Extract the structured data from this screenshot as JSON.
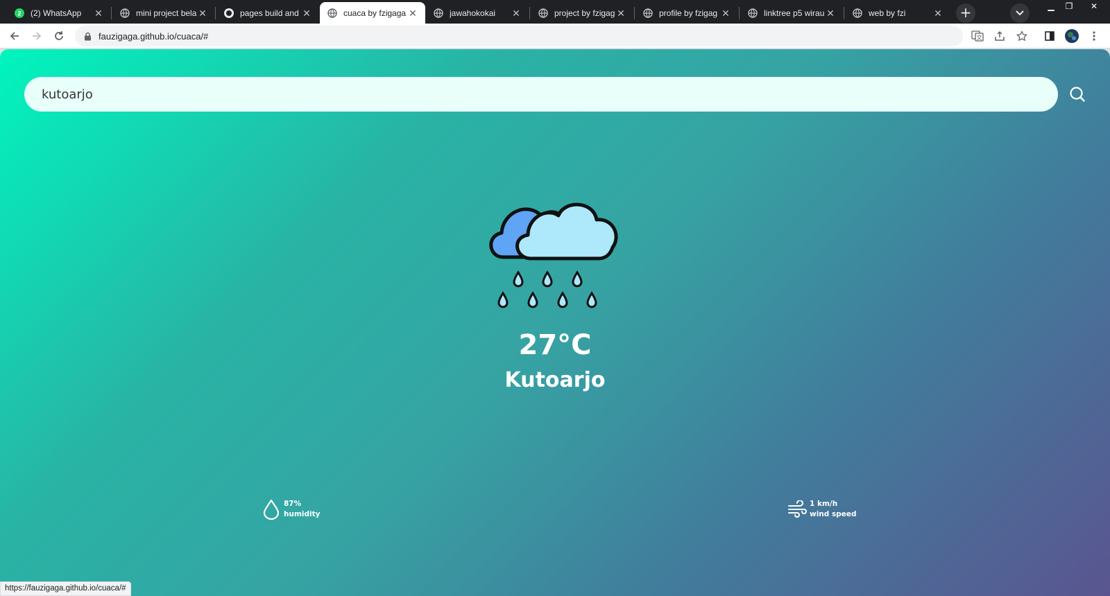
{
  "browser": {
    "tabs": [
      {
        "title": "(2) WhatsApp",
        "favicon": "whatsapp-icon"
      },
      {
        "title": "mini project bela",
        "favicon": "globe-icon"
      },
      {
        "title": "pages build and",
        "favicon": "github-icon"
      },
      {
        "title": "cuaca by fzigaga",
        "favicon": "globe-icon",
        "active": true
      },
      {
        "title": "jawahokokai",
        "favicon": "globe-icon"
      },
      {
        "title": "project by fzigag",
        "favicon": "globe-icon"
      },
      {
        "title": "profile by fzigag",
        "favicon": "globe-icon"
      },
      {
        "title": "linktree p5 wirau",
        "favicon": "globe-icon"
      },
      {
        "title": "web by fzi",
        "favicon": "globe-icon"
      }
    ],
    "whatsapp_badge": "2",
    "url": "fauzigaga.github.io/cuaca/#",
    "status_url": "https://fauzigaga.github.io/cuaca/#"
  },
  "app": {
    "search": {
      "value": "kutoarjo"
    },
    "weather_icon": "rain-cloud-icon",
    "temperature": "27°C",
    "city": "Kutoarjo",
    "humidity": {
      "value": "87%",
      "label": "humidity"
    },
    "wind": {
      "value": "1 km/h",
      "label": "wind speed"
    }
  },
  "colors": {
    "gradient_start": "#00f5be",
    "gradient_end": "#5a5590",
    "search_bg": "#e8fffa",
    "cloud_front": "#aee8fb",
    "cloud_back": "#5fa4f5"
  }
}
